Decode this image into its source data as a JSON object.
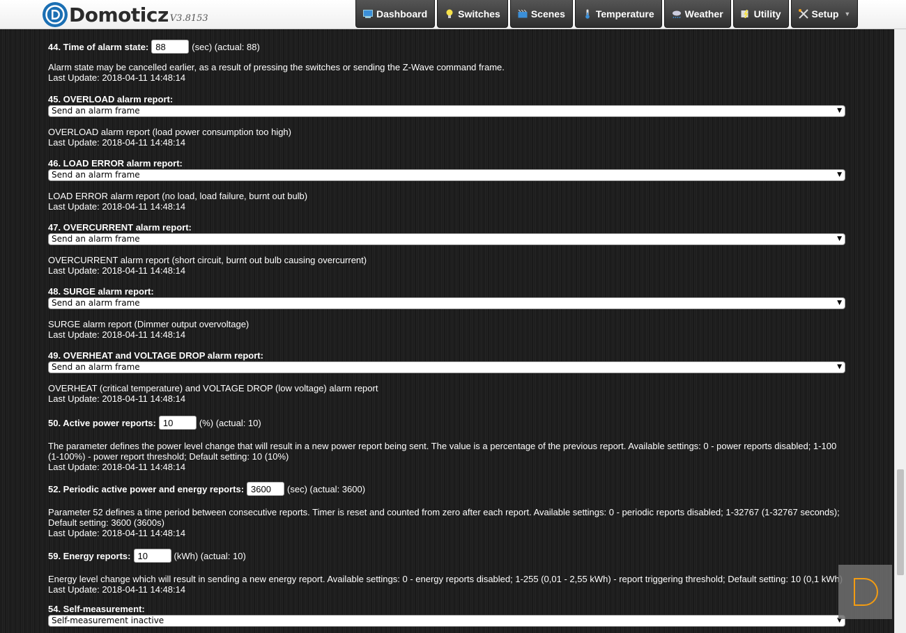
{
  "app": {
    "name": "Domoticz",
    "version": "V3.8153"
  },
  "nav": [
    {
      "label": "Dashboard",
      "icon": "dashboard-icon"
    },
    {
      "label": "Switches",
      "icon": "lightbulb-icon"
    },
    {
      "label": "Scenes",
      "icon": "scenes-icon"
    },
    {
      "label": "Temperature",
      "icon": "thermometer-icon"
    },
    {
      "label": "Weather",
      "icon": "weather-cloud-icon"
    },
    {
      "label": "Utility",
      "icon": "utility-icon"
    },
    {
      "label": "Setup",
      "icon": "tools-icon",
      "dropdown": true
    }
  ],
  "params": [
    {
      "title": "44. Time of alarm state:",
      "value": "88",
      "suffix": "(sec) (actual: 88)",
      "desc": "Alarm state may be cancelled earlier, as a result of pressing the switches or sending the Z-Wave command frame.",
      "last": "Last Update: 2018-04-11 14:48:14"
    },
    {
      "title": "45. OVERLOAD alarm report:",
      "selected": "Send an alarm frame",
      "desc": "OVERLOAD alarm report (load power consumption too high)",
      "last": "Last Update: 2018-04-11 14:48:14"
    },
    {
      "title": "46. LOAD ERROR alarm report:",
      "selected": "Send an alarm frame",
      "desc": "LOAD ERROR alarm report (no load, load failure, burnt out bulb)",
      "last": "Last Update: 2018-04-11 14:48:14"
    },
    {
      "title": "47. OVERCURRENT alarm report:",
      "selected": "Send an alarm frame",
      "desc": "OVERCURRENT alarm report (short circuit, burnt out bulb causing overcurrent)",
      "last": "Last Update: 2018-04-11 14:48:14"
    },
    {
      "title": "48. SURGE alarm report:",
      "selected": "Send an alarm frame",
      "desc": "SURGE alarm report (Dimmer output overvoltage)",
      "last": "Last Update: 2018-04-11 14:48:14"
    },
    {
      "title": "49. OVERHEAT and VOLTAGE DROP alarm report:",
      "selected": "Send an alarm frame",
      "desc": "OVERHEAT (critical temperature) and VOLTAGE DROP (low voltage) alarm report",
      "last": "Last Update: 2018-04-11 14:48:14"
    },
    {
      "title": "50. Active power reports:",
      "value": "10",
      "suffix": "(%) (actual: 10)",
      "desc": "The parameter defines the power level change that will result in a new power report being sent. The value is a percentage of the previous report. Available settings: 0 - power reports disabled; 1-100 (1-100%) - power report threshold; Default setting: 10 (10%)",
      "last": "Last Update: 2018-04-11 14:48:14"
    },
    {
      "title": "52. Periodic active power and energy reports:",
      "value": "3600",
      "suffix": "(sec) (actual: 3600)",
      "desc": "Parameter 52 defines a time period between consecutive reports. Timer is reset and counted from zero after each report. Available settings: 0 - periodic reports disabled; 1-32767 (1-32767 seconds); Default setting: 3600 (3600s)",
      "last": "Last Update: 2018-04-11 14:48:14"
    },
    {
      "title": "59. Energy reports:",
      "value": "10",
      "suffix": "(kWh) (actual: 10)",
      "desc": "Energy level change which will result in sending a new energy report. Available settings: 0 - energy reports disabled; 1-255 (0,01 - 2,55 kWh) - report triggering threshold; Default setting: 10 (0,1 kWh)",
      "last": "Last Update: 2018-04-11 14:48:14"
    },
    {
      "title": "54. Self-measurement:",
      "selected": "Self-measurement inactive"
    }
  ],
  "badge": {
    "letter": "D"
  },
  "colors": {
    "accent": "#f39c12",
    "brand": "#1b6fb3"
  }
}
